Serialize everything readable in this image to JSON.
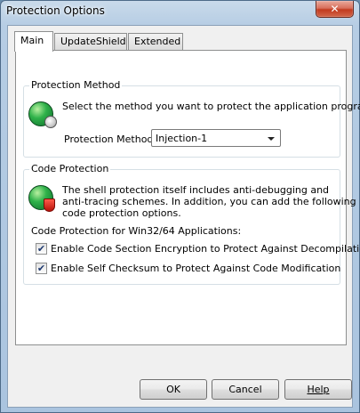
{
  "window": {
    "title": "Protection Options",
    "close_glyph": "✕"
  },
  "tabs": [
    {
      "label": "Main",
      "active": true
    },
    {
      "label": "UpdateShield",
      "active": false
    },
    {
      "label": "Extended",
      "active": false
    }
  ],
  "protection_method": {
    "group_label": "Protection Method",
    "description": "Select the method you want to protect the application program.",
    "field_label": "Protection Method:",
    "selected": "Injection-1"
  },
  "code_protection": {
    "group_label": "Code Protection",
    "description_line1": "The shell protection itself includes anti-debugging and",
    "description_line2": "anti-tracing schemes. In addition, you can add the following",
    "description_line3": "code protection options.",
    "win_label": "Code Protection for Win32/64 Applications:",
    "options": [
      {
        "label": "Enable Code Section Encryption to Protect Against Decompilation",
        "checked": true
      },
      {
        "label": "Enable Self Checksum to Protect Against Code Modification",
        "checked": true
      }
    ]
  },
  "buttons": {
    "ok": "OK",
    "cancel": "Cancel",
    "help": "Help"
  },
  "icons": {
    "method": "globe-gear-icon",
    "code": "globe-shield-icon"
  },
  "check_glyph": "✔"
}
